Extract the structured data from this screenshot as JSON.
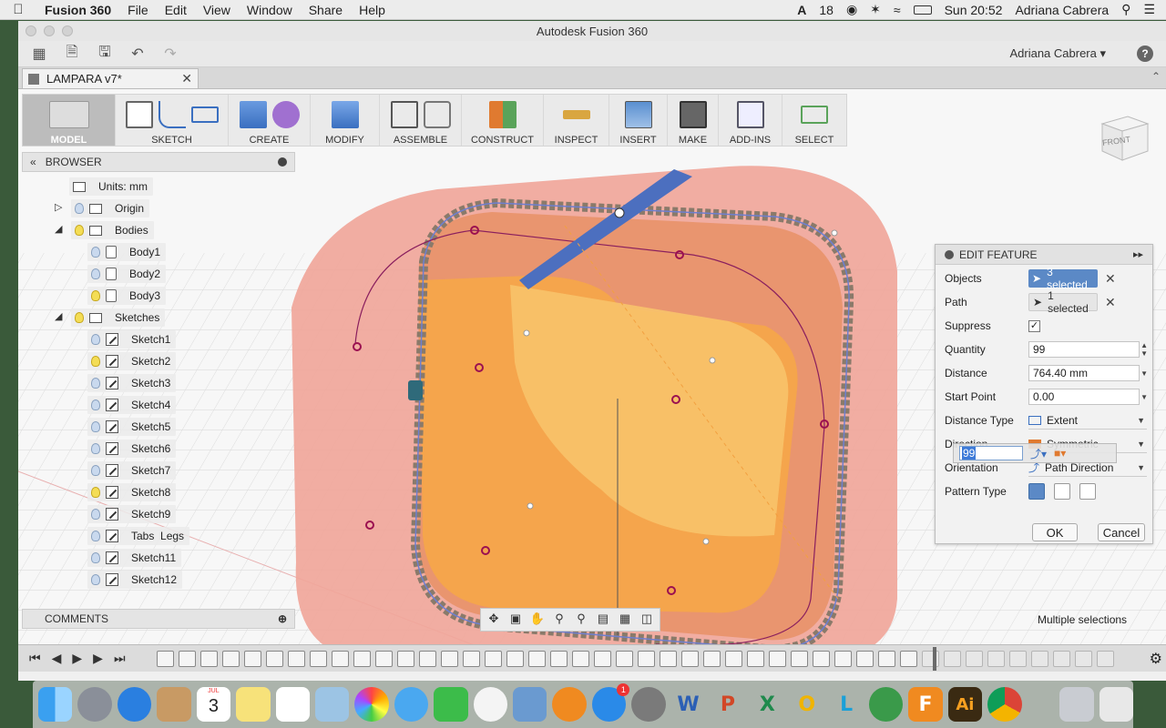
{
  "menubar": {
    "apple_icon": "apple-icon",
    "app_name": "Fusion 360",
    "menus": [
      "File",
      "Edit",
      "View",
      "Window",
      "Share",
      "Help"
    ],
    "status_count": "18",
    "clock": "Sun 20:52",
    "user": "Adriana Cabrera"
  },
  "window": {
    "title": "Autodesk Fusion 360",
    "user_menu": "Adriana Cabrera ▾",
    "help": "?"
  },
  "doc_tab": {
    "label": "LAMPARA v7*"
  },
  "toolbar": {
    "groups": [
      "MODEL",
      "SKETCH",
      "CREATE",
      "MODIFY",
      "ASSEMBLE",
      "CONSTRUCT",
      "INSPECT",
      "INSERT",
      "MAKE",
      "ADD-INS",
      "SELECT"
    ]
  },
  "browser": {
    "title": "BROWSER",
    "units": "Units: mm",
    "origin": "Origin",
    "bodies": "Bodies",
    "body_items": [
      "Body1",
      "Body2",
      "Body3"
    ],
    "sketches": "Sketches",
    "sketch_items": [
      "Sketch1",
      "Sketch2",
      "Sketch3",
      "Sketch4",
      "Sketch5",
      "Sketch6",
      "Sketch7",
      "Sketch8",
      "Sketch9",
      "Tabs  Legs",
      "Sketch11",
      "Sketch12"
    ]
  },
  "comments": {
    "title": "COMMENTS"
  },
  "edit_feature": {
    "title": "EDIT FEATURE",
    "objects_label": "Objects",
    "objects_value": "3 selected",
    "path_label": "Path",
    "path_value": "1 selected",
    "suppress_label": "Suppress",
    "suppress_checked": "✓",
    "quantity_label": "Quantity",
    "quantity_value": "99",
    "distance_label": "Distance",
    "distance_value": "764.40 mm",
    "start_label": "Start Point",
    "start_value": "0.00",
    "dtype_label": "Distance Type",
    "dtype_value": "Extent",
    "direction_label": "Direction",
    "direction_value": "Symmetric",
    "orientation_label": "Orientation",
    "orientation_value": "Path Direction",
    "pattern_label": "Pattern Type",
    "ok": "OK",
    "cancel": "Cancel"
  },
  "float_input": {
    "value": "99"
  },
  "status": {
    "multiple": "Multiple selections"
  },
  "viewcube": {
    "label": "FRONT"
  },
  "dock": {
    "calendar_month": "JUL",
    "calendar_day": "3",
    "appstore_badge": "1",
    "word": "W",
    "ppt": "P",
    "excel": "X",
    "illustrator": "Ai",
    "fusion": "F"
  }
}
